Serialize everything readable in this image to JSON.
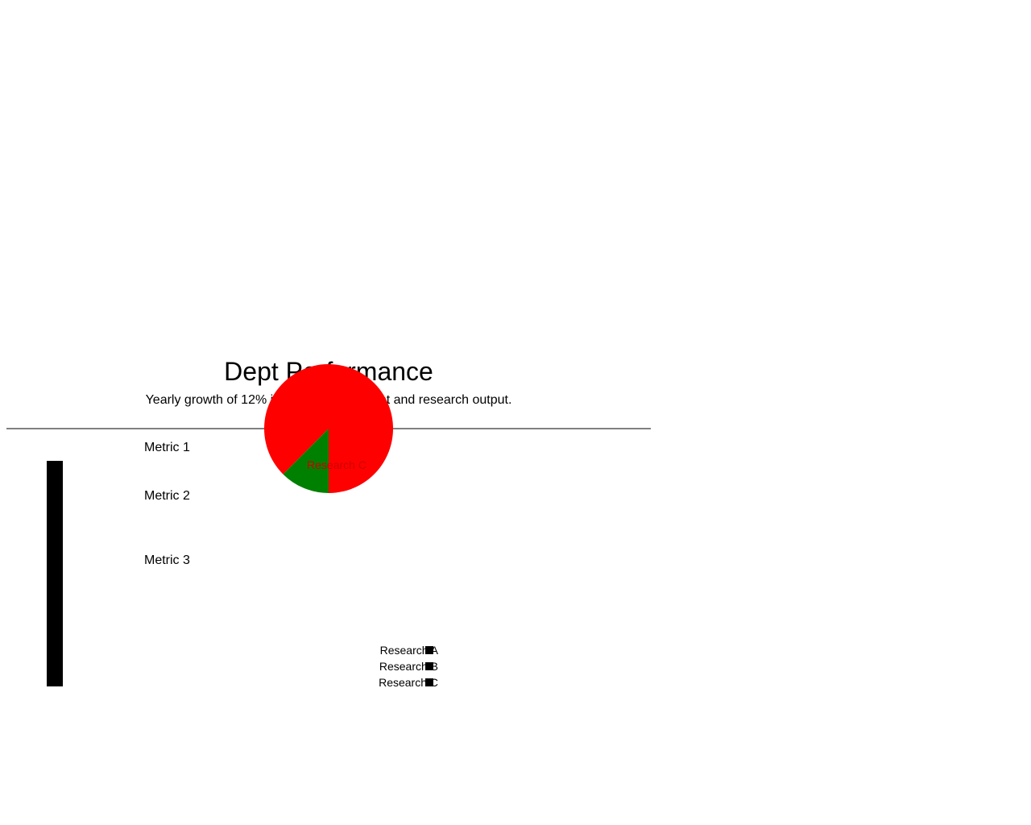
{
  "header": {
    "title": "Dept Performance",
    "subtitle": "Yearly growth of 12% in student enrollment and research output."
  },
  "metrics": [
    {
      "label": "Metric 1"
    },
    {
      "label": "Metric 2"
    },
    {
      "label": "Metric 3"
    }
  ],
  "chart_data": {
    "type": "pie",
    "slices": [
      {
        "name": "Research A",
        "value": 87.5,
        "color": "#ff0000"
      },
      {
        "name": "Research C",
        "value": 12.5,
        "color": "#008000"
      }
    ],
    "slice_label": "Research C",
    "legend": {
      "placement": "bottom",
      "entries": [
        "Research A",
        "Research B",
        "Research C"
      ],
      "swatch_color": "#000000"
    }
  },
  "colors": {
    "rule": "#808080",
    "bar": "#000000"
  }
}
